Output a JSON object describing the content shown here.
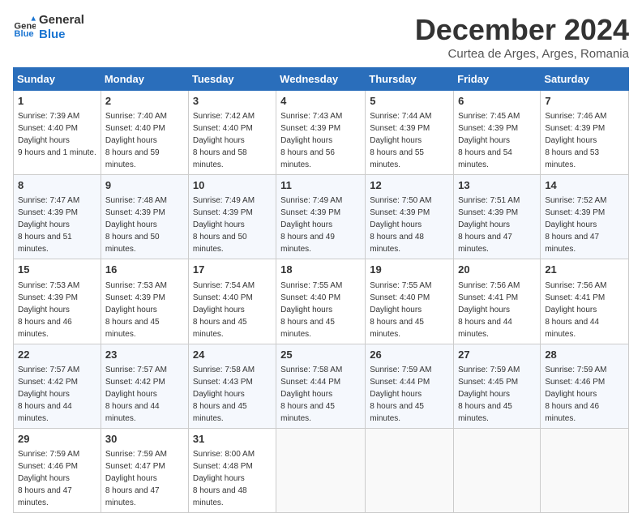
{
  "logo": {
    "line1": "General",
    "line2": "Blue"
  },
  "title": "December 2024",
  "subtitle": "Curtea de Arges, Arges, Romania",
  "days_of_week": [
    "Sunday",
    "Monday",
    "Tuesday",
    "Wednesday",
    "Thursday",
    "Friday",
    "Saturday"
  ],
  "weeks": [
    [
      {
        "day": "1",
        "sunrise": "7:39 AM",
        "sunset": "4:40 PM",
        "daylight": "9 hours and 1 minute."
      },
      {
        "day": "2",
        "sunrise": "7:40 AM",
        "sunset": "4:40 PM",
        "daylight": "8 hours and 59 minutes."
      },
      {
        "day": "3",
        "sunrise": "7:42 AM",
        "sunset": "4:40 PM",
        "daylight": "8 hours and 58 minutes."
      },
      {
        "day": "4",
        "sunrise": "7:43 AM",
        "sunset": "4:39 PM",
        "daylight": "8 hours and 56 minutes."
      },
      {
        "day": "5",
        "sunrise": "7:44 AM",
        "sunset": "4:39 PM",
        "daylight": "8 hours and 55 minutes."
      },
      {
        "day": "6",
        "sunrise": "7:45 AM",
        "sunset": "4:39 PM",
        "daylight": "8 hours and 54 minutes."
      },
      {
        "day": "7",
        "sunrise": "7:46 AM",
        "sunset": "4:39 PM",
        "daylight": "8 hours and 53 minutes."
      }
    ],
    [
      {
        "day": "8",
        "sunrise": "7:47 AM",
        "sunset": "4:39 PM",
        "daylight": "8 hours and 51 minutes."
      },
      {
        "day": "9",
        "sunrise": "7:48 AM",
        "sunset": "4:39 PM",
        "daylight": "8 hours and 50 minutes."
      },
      {
        "day": "10",
        "sunrise": "7:49 AM",
        "sunset": "4:39 PM",
        "daylight": "8 hours and 50 minutes."
      },
      {
        "day": "11",
        "sunrise": "7:49 AM",
        "sunset": "4:39 PM",
        "daylight": "8 hours and 49 minutes."
      },
      {
        "day": "12",
        "sunrise": "7:50 AM",
        "sunset": "4:39 PM",
        "daylight": "8 hours and 48 minutes."
      },
      {
        "day": "13",
        "sunrise": "7:51 AM",
        "sunset": "4:39 PM",
        "daylight": "8 hours and 47 minutes."
      },
      {
        "day": "14",
        "sunrise": "7:52 AM",
        "sunset": "4:39 PM",
        "daylight": "8 hours and 47 minutes."
      }
    ],
    [
      {
        "day": "15",
        "sunrise": "7:53 AM",
        "sunset": "4:39 PM",
        "daylight": "8 hours and 46 minutes."
      },
      {
        "day": "16",
        "sunrise": "7:53 AM",
        "sunset": "4:39 PM",
        "daylight": "8 hours and 45 minutes."
      },
      {
        "day": "17",
        "sunrise": "7:54 AM",
        "sunset": "4:40 PM",
        "daylight": "8 hours and 45 minutes."
      },
      {
        "day": "18",
        "sunrise": "7:55 AM",
        "sunset": "4:40 PM",
        "daylight": "8 hours and 45 minutes."
      },
      {
        "day": "19",
        "sunrise": "7:55 AM",
        "sunset": "4:40 PM",
        "daylight": "8 hours and 45 minutes."
      },
      {
        "day": "20",
        "sunrise": "7:56 AM",
        "sunset": "4:41 PM",
        "daylight": "8 hours and 44 minutes."
      },
      {
        "day": "21",
        "sunrise": "7:56 AM",
        "sunset": "4:41 PM",
        "daylight": "8 hours and 44 minutes."
      }
    ],
    [
      {
        "day": "22",
        "sunrise": "7:57 AM",
        "sunset": "4:42 PM",
        "daylight": "8 hours and 44 minutes."
      },
      {
        "day": "23",
        "sunrise": "7:57 AM",
        "sunset": "4:42 PM",
        "daylight": "8 hours and 44 minutes."
      },
      {
        "day": "24",
        "sunrise": "7:58 AM",
        "sunset": "4:43 PM",
        "daylight": "8 hours and 45 minutes."
      },
      {
        "day": "25",
        "sunrise": "7:58 AM",
        "sunset": "4:44 PM",
        "daylight": "8 hours and 45 minutes."
      },
      {
        "day": "26",
        "sunrise": "7:59 AM",
        "sunset": "4:44 PM",
        "daylight": "8 hours and 45 minutes."
      },
      {
        "day": "27",
        "sunrise": "7:59 AM",
        "sunset": "4:45 PM",
        "daylight": "8 hours and 45 minutes."
      },
      {
        "day": "28",
        "sunrise": "7:59 AM",
        "sunset": "4:46 PM",
        "daylight": "8 hours and 46 minutes."
      }
    ],
    [
      {
        "day": "29",
        "sunrise": "7:59 AM",
        "sunset": "4:46 PM",
        "daylight": "8 hours and 47 minutes."
      },
      {
        "day": "30",
        "sunrise": "7:59 AM",
        "sunset": "4:47 PM",
        "daylight": "8 hours and 47 minutes."
      },
      {
        "day": "31",
        "sunrise": "8:00 AM",
        "sunset": "4:48 PM",
        "daylight": "8 hours and 48 minutes."
      },
      null,
      null,
      null,
      null
    ]
  ],
  "labels": {
    "sunrise": "Sunrise:",
    "sunset": "Sunset:",
    "daylight": "Daylight hours"
  }
}
